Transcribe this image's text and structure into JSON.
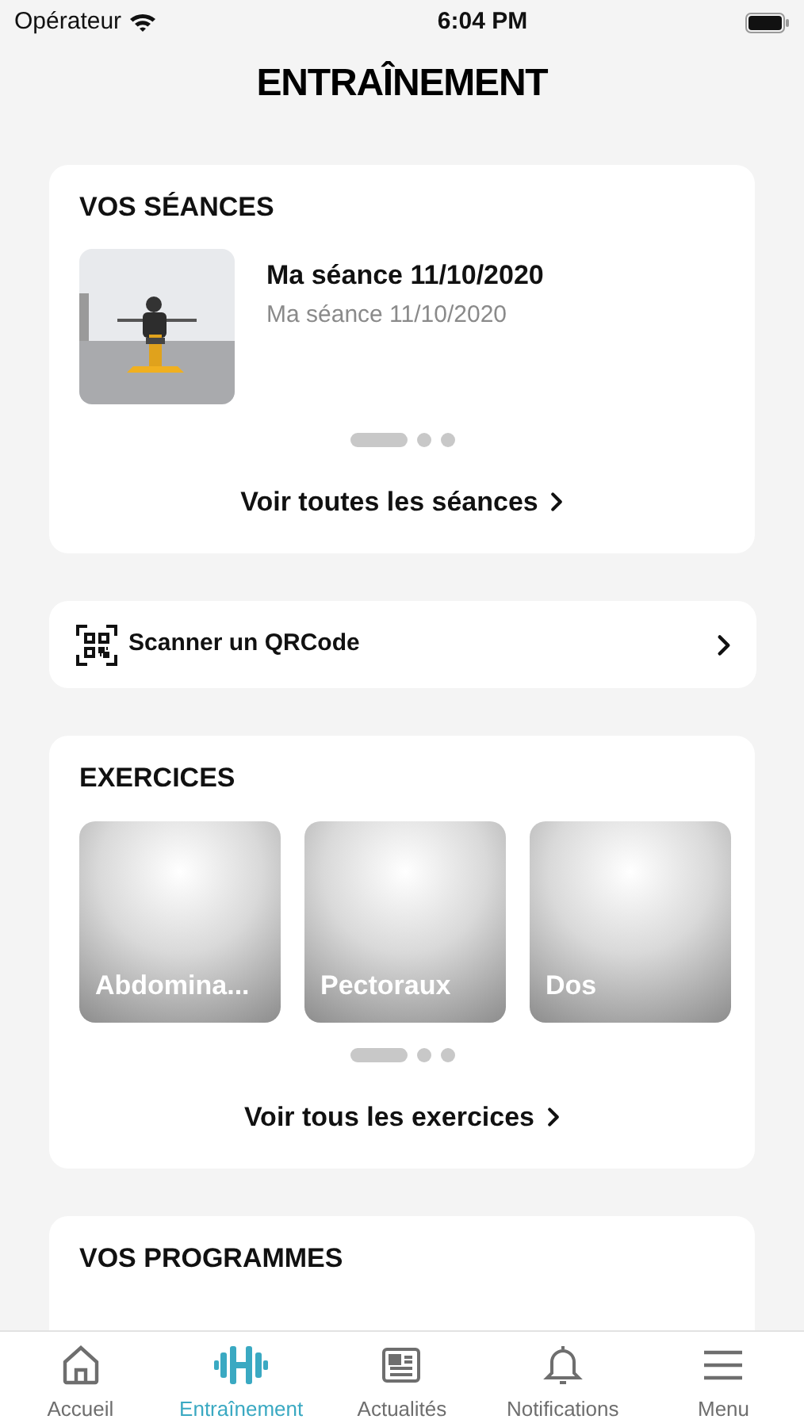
{
  "status_bar": {
    "carrier": "Opérateur",
    "time": "6:04 PM"
  },
  "title": "ENTRAÎNEMENT",
  "sessions": {
    "heading": "VOS SÉANCES",
    "items": [
      {
        "title": "Ma séance 11/10/2020",
        "subtitle": "Ma séance 11/10/2020"
      }
    ],
    "pages": [
      {
        "selected": true
      },
      {
        "selected": false
      },
      {
        "selected": false
      }
    ],
    "link": "Voir toutes les séances"
  },
  "qr": {
    "label": "Scanner un QRCode"
  },
  "exercises": {
    "heading": "EXERCICES",
    "items": [
      {
        "label": "Abdomina..."
      },
      {
        "label": "Pectoraux"
      },
      {
        "label": "Dos"
      }
    ],
    "pages": [
      {
        "selected": true
      },
      {
        "selected": false
      },
      {
        "selected": false
      }
    ],
    "link": "Voir tous les exercices"
  },
  "programs": {
    "heading": "VOS PROGRAMMES"
  },
  "tab_bar": [
    {
      "label": "Accueil",
      "selected": false
    },
    {
      "label": "Entraînement",
      "selected": true
    },
    {
      "label": "Actualités",
      "selected": false
    },
    {
      "label": "Notifications",
      "selected": false
    },
    {
      "label": "Menu",
      "selected": false
    }
  ]
}
